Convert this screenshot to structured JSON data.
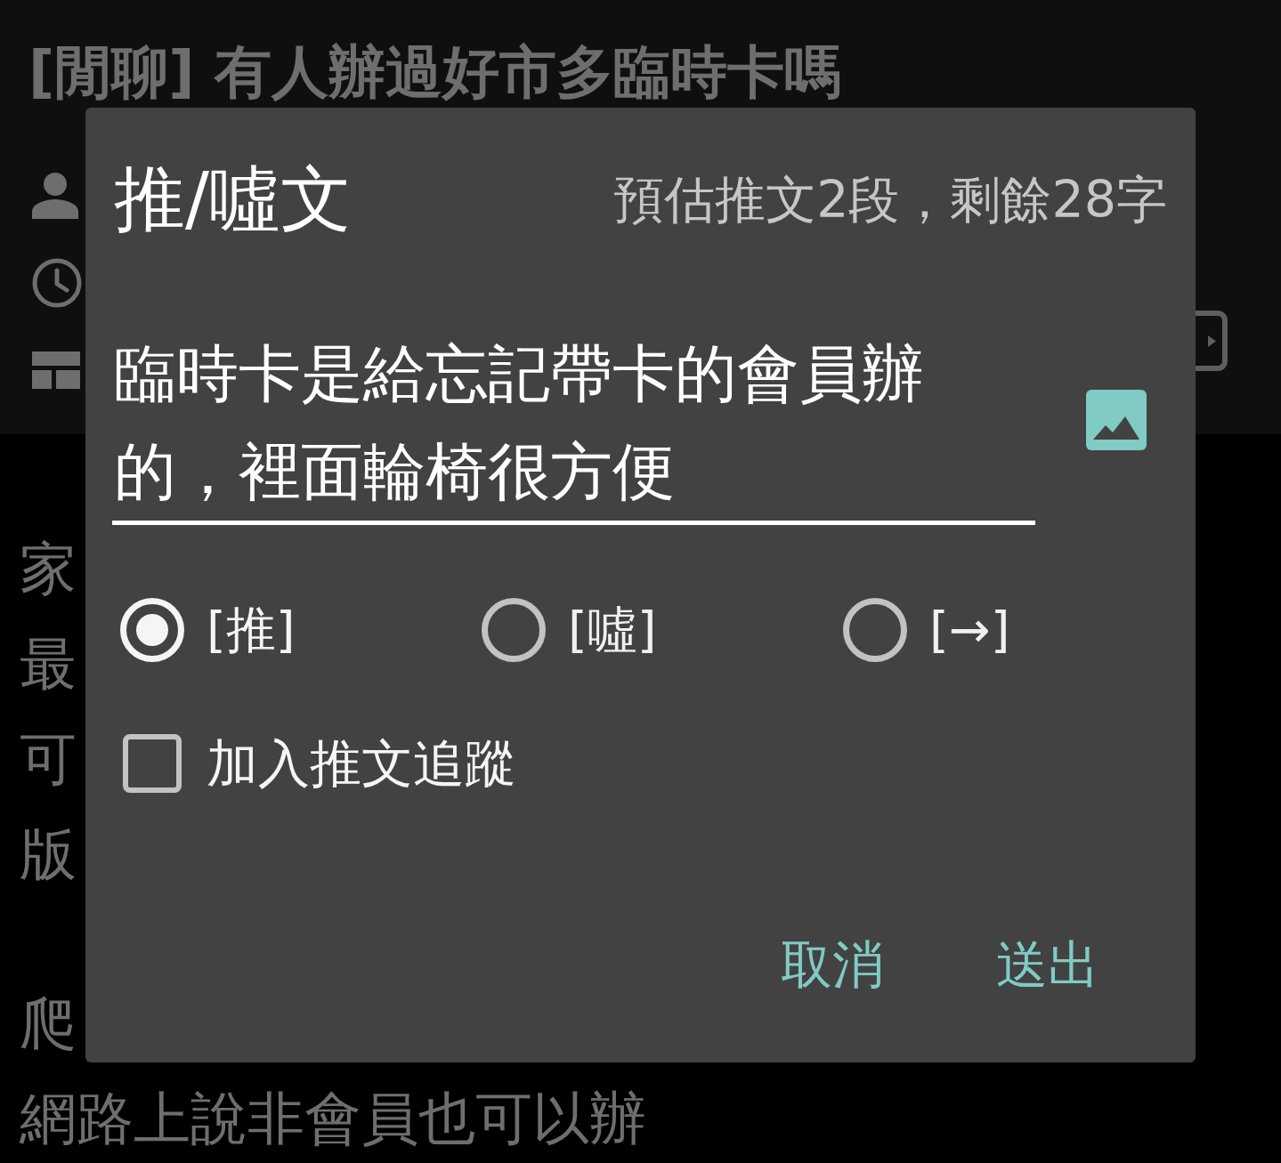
{
  "article": {
    "title": "[閒聊] 有人辦過好市多臨時卡嗎",
    "paragraphs": [
      [
        "家",
        "最",
        "可",
        "版"
      ],
      [
        "爬",
        "網路上說非會員也可以辦"
      ]
    ]
  },
  "dialog": {
    "title": "推/噓文",
    "counter": "預估推文2段，剩餘28字",
    "comment": {
      "value": "臨時卡是給忘記帶卡的會員辦的，裡面輪椅很方便"
    },
    "types": [
      {
        "label": "[推]",
        "selected": true
      },
      {
        "label": "[噓]",
        "selected": false
      },
      {
        "label": "[→]",
        "selected": false
      }
    ],
    "track_option": {
      "label": "加入推文追蹤",
      "checked": false
    },
    "buttons": [
      "取消",
      "送出"
    ]
  }
}
